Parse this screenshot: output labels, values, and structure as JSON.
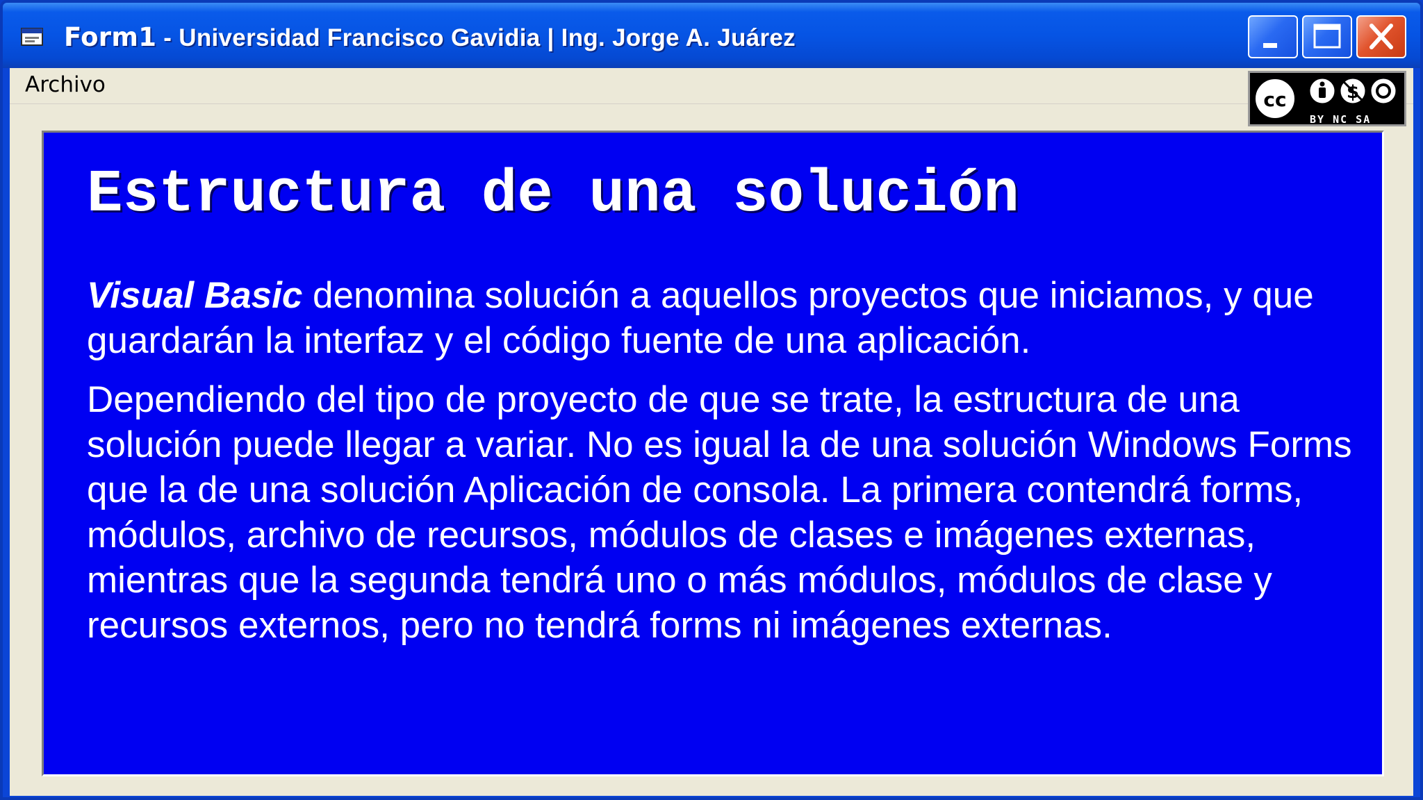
{
  "window": {
    "title_form": "Form1",
    "title_rest": " - Universidad Francisco Gavidia | Ing. Jorge A. Juárez",
    "minimize_icon": "minimize-icon",
    "maximize_icon": "maximize-icon",
    "close_icon": "close-icon"
  },
  "menu": {
    "items": [
      {
        "label": "Archivo"
      }
    ]
  },
  "license_badge": {
    "icons": [
      "cc-icon",
      "by-icon",
      "nc-icon",
      "sa-icon"
    ],
    "labels": "BY NC SA"
  },
  "slide": {
    "heading": "Estructura de una solución",
    "paragraph1_emphasis": "Visual Basic",
    "paragraph1_rest": " denomina solución a aquellos proyectos que iniciamos, y que guardarán la interfaz y el código fuente de una aplicación.",
    "paragraph2": "Dependiendo del tipo de proyecto de que se trate, la estructura de una solución puede llegar a variar. No es igual la de una solución Windows Forms que la de una solución Aplicación de consola. La primera contendrá forms, módulos, archivo de recursos, módulos de clases e imágenes externas, mientras que la segunda tendrá uno o más módulos, módulos de clase y recursos externos, pero no tendrá forms ni imágenes externas."
  },
  "colors": {
    "titlebar": "#0654e4",
    "slide_background": "#0000f2",
    "client_background": "#ece9d8",
    "text": "#ffffff",
    "close_button": "#e1542d"
  }
}
